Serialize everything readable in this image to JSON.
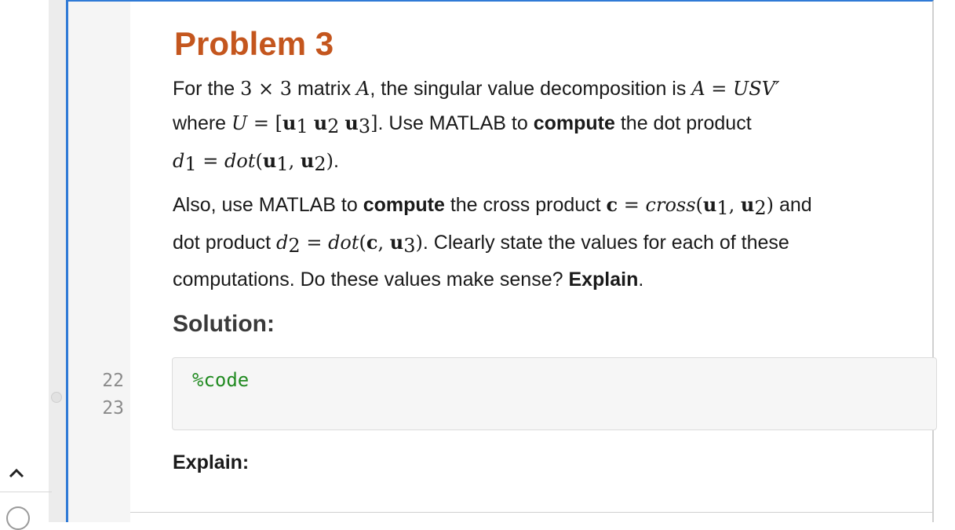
{
  "gutter": {
    "line_numbers": [
      "22",
      "23"
    ]
  },
  "problem": {
    "title": "Problem 3",
    "p1": {
      "t1": "For the ",
      "m1": "3 × 3",
      "t2": " matrix ",
      "m2": "A",
      "t3": ", the singular value decomposition is ",
      "m3": "A = USV′",
      "t4": "where ",
      "m4_lhs": "U = ",
      "u": "u",
      "s1": "1",
      "s2": "2",
      "s3": "3",
      "t5": ". Use MATLAB to ",
      "bold1": "compute",
      "t6": " the dot product",
      "d": "d",
      "eq": " = ",
      "dot_fn": "dot",
      "t7": "."
    },
    "p2": {
      "t1": "Also, use MATLAB to ",
      "bold1": "compute",
      "t2": " the cross product ",
      "c": "c",
      "eq": " = ",
      "cross_fn": "cross",
      "t3": " and",
      "t4": "dot product ",
      "d": "d",
      "s2": "2",
      "dot_fn": "dot",
      "s3": "3",
      "u": "u",
      "s1": "1",
      "t5": ". Clearly state the values for each of these",
      "t6": "computations. Do these values make sense? ",
      "bold2": "Explain",
      "t7": "."
    }
  },
  "solution": {
    "heading": "Solution:",
    "code": "%code"
  },
  "explain": {
    "heading": "Explain:"
  },
  "colors": {
    "title": "#c4561e",
    "code_comment": "#228b22",
    "selection_border": "#2f7ad6"
  },
  "icons": {
    "collapse": "chevron-up-icon",
    "bottom": "circle-icon"
  }
}
